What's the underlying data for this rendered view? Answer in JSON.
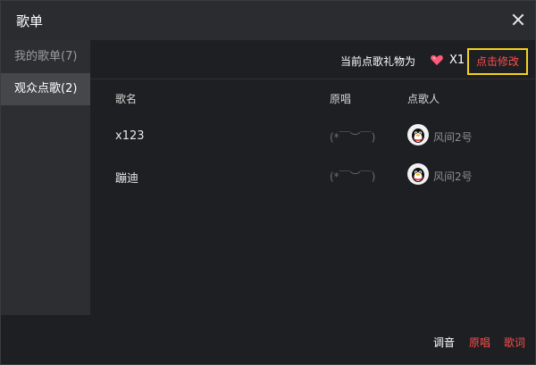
{
  "window": {
    "title": "歌单"
  },
  "sidebar": {
    "items": [
      {
        "label": "我的歌单(7)"
      },
      {
        "label": "观众点歌(2)"
      }
    ]
  },
  "gift": {
    "label": "当前点歌礼物为",
    "count": "X1",
    "modify_label": "点击修改"
  },
  "table": {
    "headers": [
      "歌名",
      "原唱",
      "点歌人"
    ],
    "rows": [
      {
        "song": "x123",
        "original": "(*￣︶￣)",
        "requester": "风间2号"
      },
      {
        "song": "蹦迪",
        "original": "(*￣︶￣)",
        "requester": "风间2号"
      }
    ]
  },
  "footer": {
    "tune": "调音",
    "original": "原唱",
    "lyrics": "歌词"
  },
  "colors": {
    "accent": "#ff4d4d",
    "highlight": "#f4d21f"
  }
}
